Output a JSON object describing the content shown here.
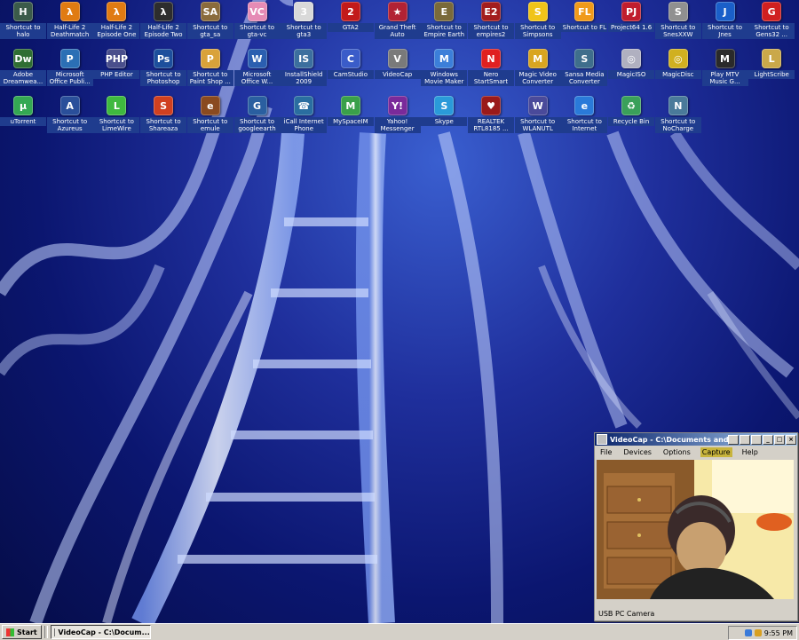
{
  "desktop": {
    "icons": [
      {
        "label": "Shortcut to halo",
        "icon": "halo-icon",
        "color": "#3b5b4a",
        "glyph": "H"
      },
      {
        "label": "Half-Life 2 Deathmatch",
        "icon": "half-life-icon",
        "color": "#e07b12",
        "glyph": "λ"
      },
      {
        "label": "Half-Life 2 Episode One",
        "icon": "half-life-icon",
        "color": "#e07b12",
        "glyph": "λ"
      },
      {
        "label": "Half-Life 2 Episode Two",
        "icon": "half-life-icon",
        "color": "#2d2d2d",
        "glyph": "λ"
      },
      {
        "label": "Shortcut to gta_sa",
        "icon": "gta-sa-icon",
        "color": "#8a6b3c",
        "glyph": "SA"
      },
      {
        "label": "Shortcut to gta-vc",
        "icon": "gta-vc-icon",
        "color": "#e58bb5",
        "glyph": "VC"
      },
      {
        "label": "Shortcut to gta3",
        "icon": "gta3-icon",
        "color": "#d9d9d9",
        "glyph": "3"
      },
      {
        "label": "GTA2",
        "icon": "gta2-icon",
        "color": "#c21a1a",
        "glyph": "2"
      },
      {
        "label": "Grand Theft Auto",
        "icon": "us-flag-icon",
        "color": "#b22234",
        "glyph": "★"
      },
      {
        "label": "Shortcut to Empire Earth",
        "icon": "empire-earth-icon",
        "color": "#7a6a3a",
        "glyph": "E"
      },
      {
        "label": "Shortcut to empires2",
        "icon": "empires2-icon",
        "color": "#a31d1d",
        "glyph": "E2"
      },
      {
        "label": "Shortcut to Simpsons",
        "icon": "simpsons-icon",
        "color": "#f0c419",
        "glyph": "S"
      },
      {
        "label": "Shortcut to FL",
        "icon": "fl-studio-icon",
        "color": "#f09a1a",
        "glyph": "FL"
      },
      {
        "label": "Project64 1.6",
        "icon": "project64-icon",
        "color": "#c01e2e",
        "glyph": "PJ"
      },
      {
        "label": "Shortcut to SnesXXW",
        "icon": "snes-icon",
        "color": "#909090",
        "glyph": "S"
      },
      {
        "label": "Shortcut to Jnes",
        "icon": "jnes-icon",
        "color": "#1a5fc9",
        "glyph": "J"
      },
      {
        "label": "Shortcut to Gens32 ...",
        "icon": "gens-icon",
        "color": "#d02020",
        "glyph": "G"
      },
      {
        "label": "Adobe Dreamwea...",
        "icon": "dreamweaver-icon",
        "color": "#2f6e32",
        "glyph": "Dw"
      },
      {
        "label": "Microsoft Office Publi...",
        "icon": "publisher-icon",
        "color": "#2b6fb5",
        "glyph": "P"
      },
      {
        "label": "PHP Editor",
        "icon": "php-editor-icon",
        "color": "#4a4f8c",
        "glyph": "PHP"
      },
      {
        "label": "Shortcut to Photoshop",
        "icon": "photoshop-icon",
        "color": "#1d4f9c",
        "glyph": "Ps"
      },
      {
        "label": "Shortcut to Paint Shop ...",
        "icon": "paint-shop-icon",
        "color": "#d9a23a",
        "glyph": "P"
      },
      {
        "label": "Microsoft Office W...",
        "icon": "word-icon",
        "color": "#2b5fb0",
        "glyph": "W"
      },
      {
        "label": "InstallShield 2009",
        "icon": "installshield-icon",
        "color": "#3c6f9e",
        "glyph": "IS"
      },
      {
        "label": "CamStudio",
        "icon": "camstudio-icon",
        "color": "#3a5cc9",
        "glyph": "C"
      },
      {
        "label": "VideoCap",
        "icon": "videocap-icon",
        "color": "#7a7a7a",
        "glyph": "V"
      },
      {
        "label": "Windows Movie Maker",
        "icon": "movie-maker-icon",
        "color": "#3c7fd9",
        "glyph": "M"
      },
      {
        "label": "Nero StartSmart",
        "icon": "nero-icon",
        "color": "#e02020",
        "glyph": "N"
      },
      {
        "label": "Magic Video Converter",
        "icon": "magic-video-icon",
        "color": "#d9a520",
        "glyph": "M"
      },
      {
        "label": "Sansa Media Converter",
        "icon": "sansa-icon",
        "color": "#3f6e8c",
        "glyph": "S"
      },
      {
        "label": "MagicISO",
        "icon": "magiciso-icon",
        "color": "#b0b0c0",
        "glyph": "◎"
      },
      {
        "label": "MagicDisc",
        "icon": "magicdisc-icon",
        "color": "#d0b020",
        "glyph": "◎"
      },
      {
        "label": "Play MTV Music G...",
        "icon": "mtv-icon",
        "color": "#2a2a2a",
        "glyph": "M"
      },
      {
        "label": "LightScribe",
        "icon": "lightscribe-icon",
        "color": "#caa84a",
        "glyph": "L"
      },
      {
        "label": "uTorrent",
        "icon": "utorrent-icon",
        "color": "#34a853",
        "glyph": "µ"
      },
      {
        "label": "Shortcut to Azureus",
        "icon": "azureus-icon",
        "color": "#2a4f9a",
        "glyph": "A"
      },
      {
        "label": "Shortcut to LimeWire",
        "icon": "limewire-icon",
        "color": "#3fb93f",
        "glyph": "L"
      },
      {
        "label": "Shortcut to Shareaza",
        "icon": "shareaza-icon",
        "color": "#d04020",
        "glyph": "S"
      },
      {
        "label": "Shortcut to emule",
        "icon": "emule-icon",
        "color": "#8a4a20",
        "glyph": "e"
      },
      {
        "label": "Shortcut to googleearth",
        "icon": "google-earth-icon",
        "color": "#2a5fa0",
        "glyph": "G"
      },
      {
        "label": "iCall Internet Phone",
        "icon": "icall-icon",
        "color": "#2a6ea0",
        "glyph": "☎"
      },
      {
        "label": "MySpaceIM",
        "icon": "myspace-icon",
        "color": "#3aa04a",
        "glyph": "M"
      },
      {
        "label": "Yahoo! Messenger",
        "icon": "yahoo-icon",
        "color": "#7a2a9a",
        "glyph": "Y!"
      },
      {
        "label": "Skype",
        "icon": "skype-icon",
        "color": "#2a9ad9",
        "glyph": "S"
      },
      {
        "label": "REALTEK RTL8185 ...",
        "icon": "realtek-icon",
        "color": "#9a1a1a",
        "glyph": "♥"
      },
      {
        "label": "Shortcut to WLANUTL",
        "icon": "wlanutl-icon",
        "color": "#4a4a9a",
        "glyph": "W"
      },
      {
        "label": "Shortcut to Internet",
        "icon": "internet-explorer-icon",
        "color": "#2a7ad9",
        "glyph": "e"
      },
      {
        "label": "Recycle Bin",
        "icon": "recycle-bin-icon",
        "color": "#3aa05a",
        "glyph": "♻"
      },
      {
        "label": "Shortcut to NoCharge",
        "icon": "nocharge-icon",
        "color": "#4a7a9a",
        "glyph": "N"
      }
    ]
  },
  "videocap": {
    "title": "VideoCap - C:\\Documents and",
    "menus": [
      "File",
      "Devices",
      "Options",
      "Capture",
      "Help"
    ],
    "active_menu": "Capture",
    "status": "USB PC Camera"
  },
  "taskbar": {
    "start_label": "Start",
    "task_label": "VideoCap - C:\\Docum...",
    "clock": "9:55 PM"
  }
}
